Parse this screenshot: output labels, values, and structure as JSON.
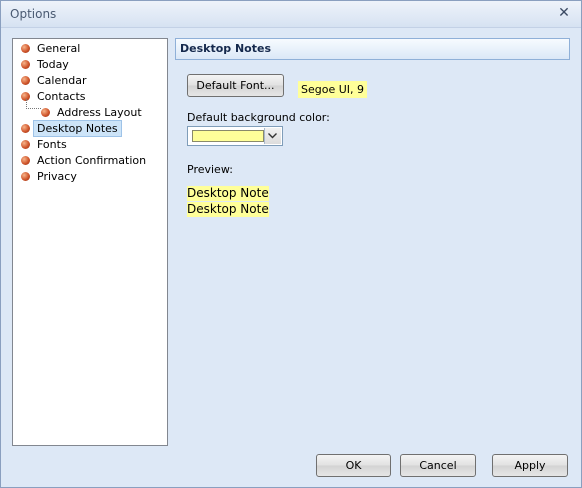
{
  "window": {
    "title": "Options",
    "close_glyph": "✕"
  },
  "tree": {
    "items": [
      {
        "label": "General"
      },
      {
        "label": "Today"
      },
      {
        "label": "Calendar"
      },
      {
        "label": "Contacts"
      },
      {
        "label": "Address Layout"
      },
      {
        "label": "Desktop Notes",
        "selected": true
      },
      {
        "label": "Fonts"
      },
      {
        "label": "Action Confirmation"
      },
      {
        "label": "Privacy"
      }
    ]
  },
  "panel": {
    "title": "Desktop Notes",
    "default_font_button": "Default Font...",
    "font_value": "Segoe UI, 9",
    "bg_color_label": "Default background color:",
    "bg_color_value": "#ffff99",
    "preview_label": "Preview:",
    "preview_lines": [
      "Desktop Note",
      "Desktop Note"
    ]
  },
  "buttons": {
    "ok": "OK",
    "cancel": "Cancel",
    "apply": "Apply"
  }
}
